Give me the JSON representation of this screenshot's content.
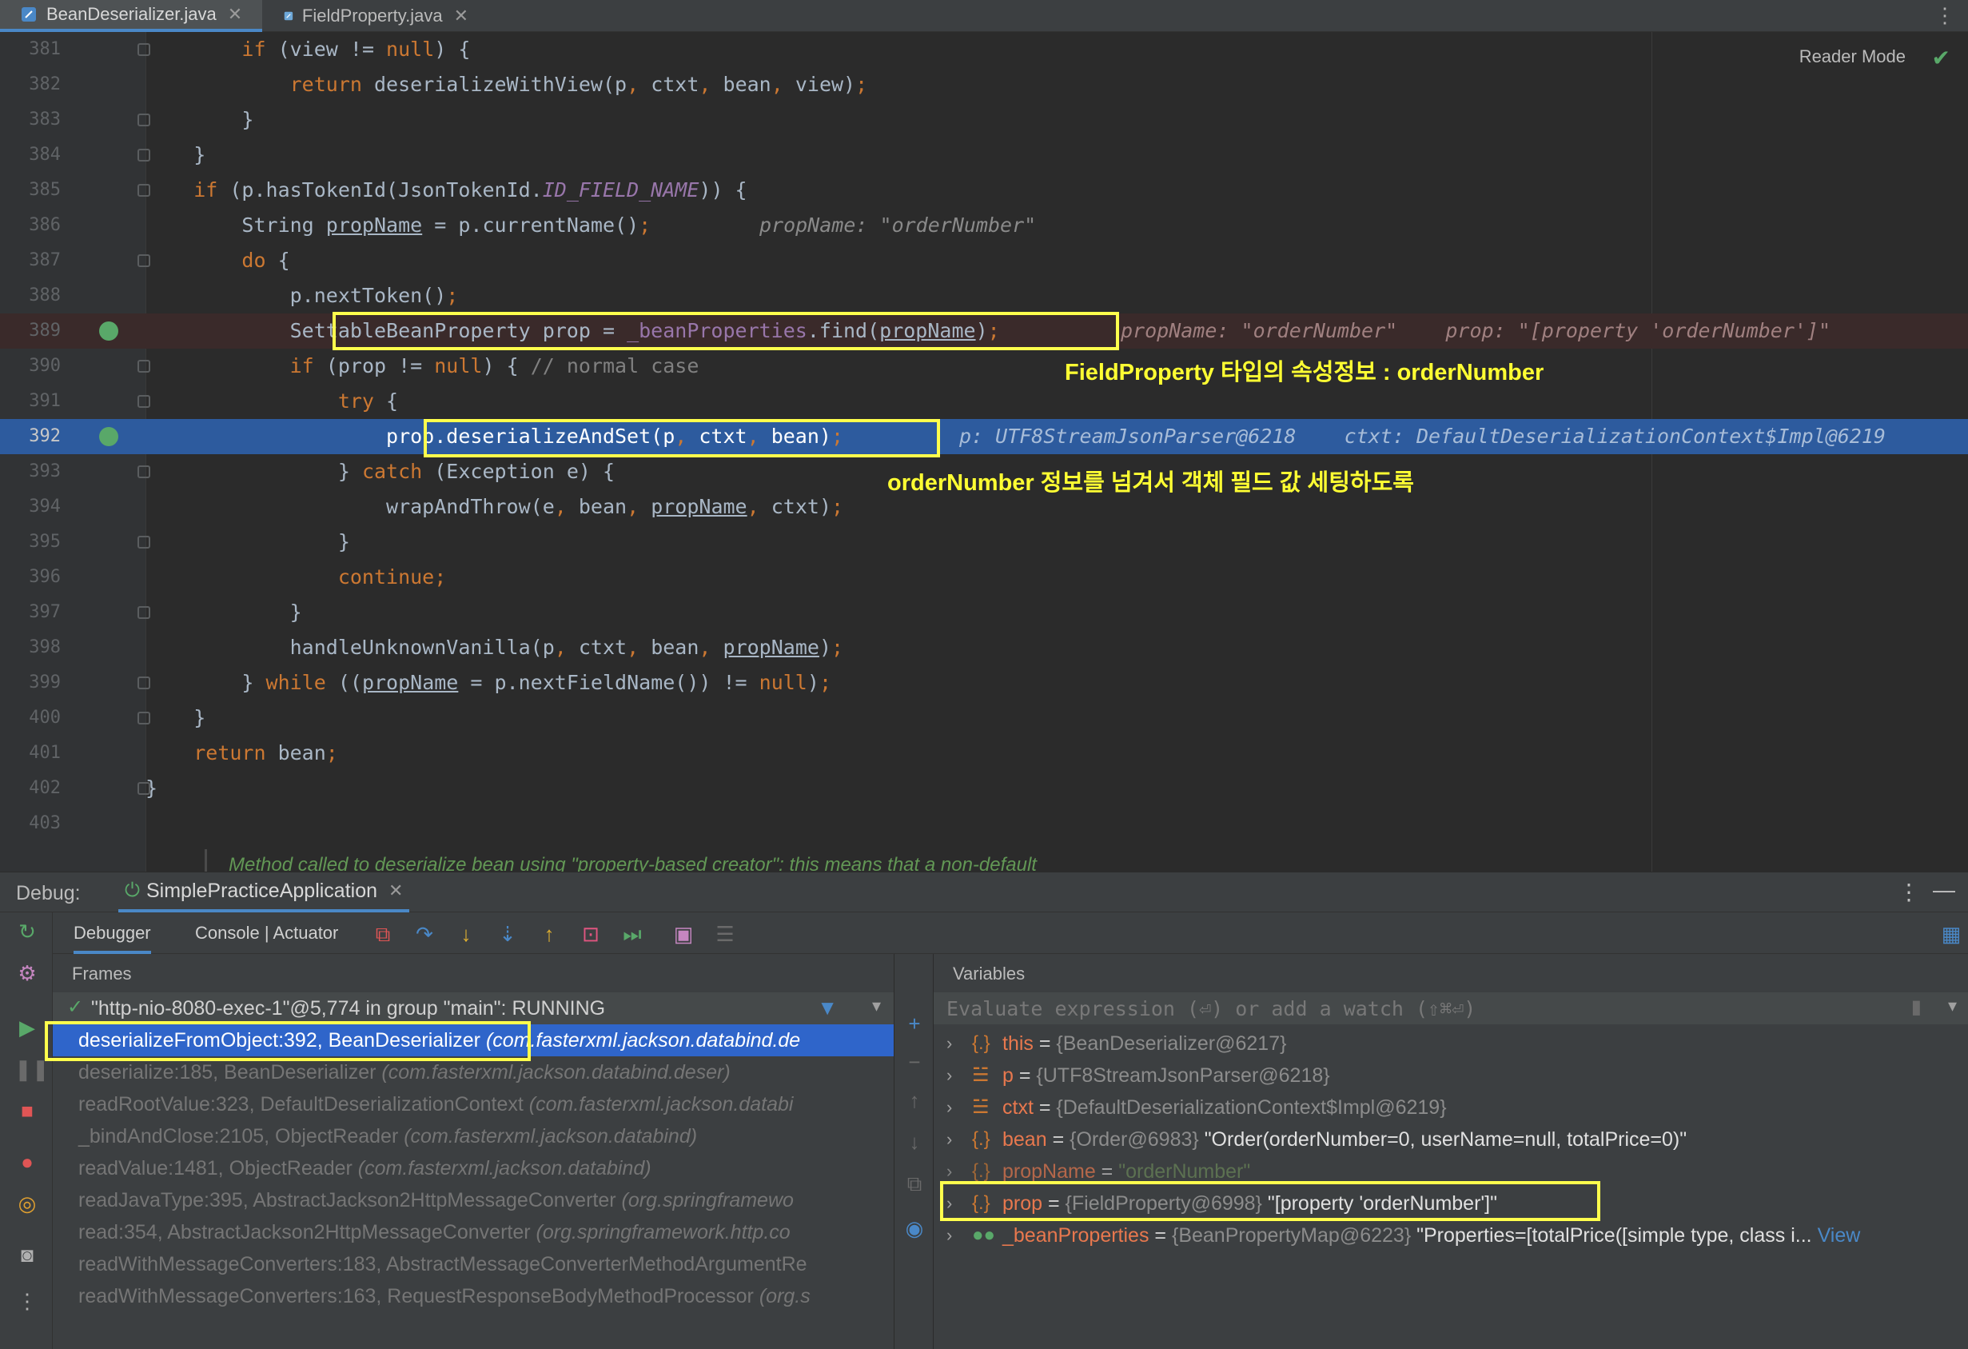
{
  "tabs": [
    {
      "label": "BeanDeserializer.java",
      "active": true
    },
    {
      "label": "FieldProperty.java",
      "active": false
    }
  ],
  "editor": {
    "reader_mode": "Reader Mode",
    "lines": [
      {
        "num": "381",
        "code": "        if (view != null) {"
      },
      {
        "num": "382",
        "code": "            return deserializeWithView(p, ctxt, bean, view);"
      },
      {
        "num": "383",
        "code": "        }"
      },
      {
        "num": "384",
        "code": "    }"
      },
      {
        "num": "385",
        "code": "    if (p.hasTokenId(JsonTokenId.ID_FIELD_NAME)) {"
      },
      {
        "num": "386",
        "code": "        String propName = p.currentName();",
        "hint": "propName: \"orderNumber\""
      },
      {
        "num": "387",
        "code": "        do {"
      },
      {
        "num": "388",
        "code": "            p.nextToken();"
      },
      {
        "num": "389",
        "code": "            SettableBeanProperty prop = _beanProperties.find(propName);",
        "hint": "propName: \"orderNumber\"    prop: \"[property 'orderNumber']\""
      },
      {
        "num": "390",
        "code": "            if (prop != null) { // normal case"
      },
      {
        "num": "391",
        "code": "                try {"
      },
      {
        "num": "392",
        "code": "                    prop.deserializeAndSet(p, ctxt, bean);",
        "hint": "p: UTF8StreamJsonParser@6218    ctxt: DefaultDeserializationContext$Impl@6219"
      },
      {
        "num": "393",
        "code": "                } catch (Exception e) {"
      },
      {
        "num": "394",
        "code": "                    wrapAndThrow(e, bean, propName, ctxt);"
      },
      {
        "num": "395",
        "code": "                }"
      },
      {
        "num": "396",
        "code": "                continue;"
      },
      {
        "num": "397",
        "code": "            }"
      },
      {
        "num": "398",
        "code": "            handleUnknownVanilla(p, ctxt, bean, propName);"
      },
      {
        "num": "399",
        "code": "        } while ((propName = p.nextFieldName()) != null);"
      },
      {
        "num": "400",
        "code": "    }"
      },
      {
        "num": "401",
        "code": "    return bean;"
      },
      {
        "num": "402",
        "code": "}"
      },
      {
        "num": "403",
        "code": ""
      }
    ],
    "doc_comment": "Method called to deserialize bean using \"property-based creator\": this means that a non-default",
    "annotation_1": "FieldProperty 타입의 속성정보 : orderNumber",
    "annotation_2": "orderNumber 정보를 넘겨서 객체 필드 값 세팅하도록"
  },
  "debug": {
    "label": "Debug:",
    "run_tab": "SimplePracticeApplication",
    "tabs": [
      "Debugger",
      "Console | Actuator"
    ],
    "frames_title": "Frames",
    "thread": "\"http-nio-8080-exec-1\"@5,774 in group \"main\": RUNNING",
    "frames": [
      {
        "method": "deserializeFromObject:392, BeanDeserializer",
        "pkg": "(com.fasterxml.jackson.databind.de"
      },
      {
        "method": "deserialize:185, BeanDeserializer",
        "pkg": "(com.fasterxml.jackson.databind.deser)"
      },
      {
        "method": "readRootValue:323, DefaultDeserializationContext",
        "pkg": "(com.fasterxml.jackson.databi"
      },
      {
        "method": "_bindAndClose:2105, ObjectReader",
        "pkg": "(com.fasterxml.jackson.databind)"
      },
      {
        "method": "readValue:1481, ObjectReader",
        "pkg": "(com.fasterxml.jackson.databind)"
      },
      {
        "method": "readJavaType:395, AbstractJackson2HttpMessageConverter",
        "pkg": "(org.springframewo"
      },
      {
        "method": "read:354, AbstractJackson2HttpMessageConverter",
        "pkg": "(org.springframework.http.co"
      },
      {
        "method": "readWithMessageConverters:183, AbstractMessageConverterMethodArgumentRe",
        "pkg": ""
      },
      {
        "method": "readWithMessageConverters:163, RequestResponseBodyMethodProcessor",
        "pkg": "(org.s"
      }
    ],
    "variables_title": "Variables",
    "eval_placeholder": "Evaluate expression (⏎) or add a watch (⇧⌘⏎)",
    "variables": [
      {
        "name": "this",
        "type": "{BeanDeserializer@6217}",
        "value": ""
      },
      {
        "name": "p",
        "type": "{UTF8StreamJsonParser@6218}",
        "value": ""
      },
      {
        "name": "ctxt",
        "type": "{DefaultDeserializationContext$Impl@6219}",
        "value": ""
      },
      {
        "name": "bean",
        "type": "{Order@6983}",
        "value": "\"Order(orderNumber=0, userName=null, totalPrice=0)\""
      },
      {
        "name": "propName",
        "type": "",
        "value": "\"orderNumber\""
      },
      {
        "name": "prop",
        "type": "{FieldProperty@6998}",
        "value": "\"[property 'orderNumber']\""
      },
      {
        "name": "_beanProperties",
        "type": "{BeanPropertyMap@6223}",
        "value": "\"Properties=[totalPrice([simple type, class i...",
        "link": "View"
      }
    ]
  },
  "colors": {
    "highlight": "#ffff4d",
    "selection": "#2f65ca",
    "exec_line": "#2d5b9e"
  }
}
